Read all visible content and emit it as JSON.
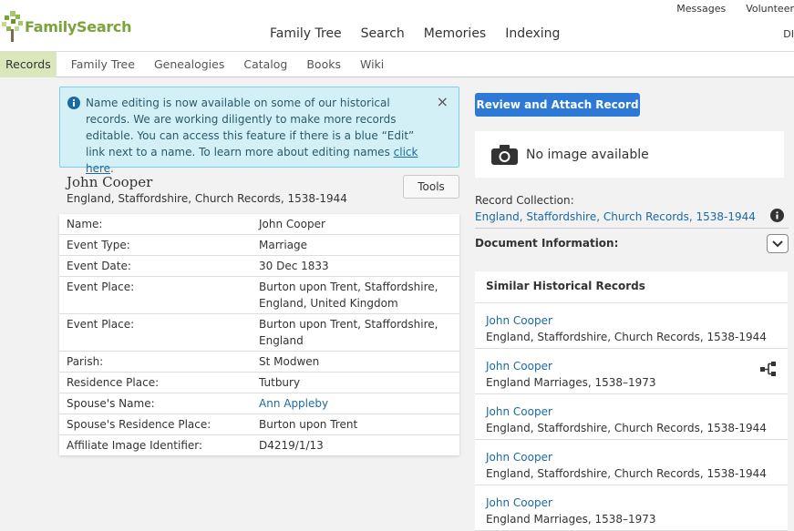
{
  "header": {
    "logo_text": "FamilySearch",
    "top_links": [
      "Messages",
      "Volunteer"
    ],
    "user_initials": "DI",
    "main_nav": [
      "Family Tree",
      "Search",
      "Memories",
      "Indexing"
    ]
  },
  "subnav": {
    "items": [
      "Records",
      "Family Tree",
      "Genealogies",
      "Catalog",
      "Books",
      "Wiki"
    ],
    "active": "Records"
  },
  "notice": {
    "text": "Name editing is now available on some of our historical records. We are working diligently to make more records editable. You can access this feature if there is a blue “Edit” link next to a name. To learn more about editing names ",
    "link_text": "click here",
    "suffix": ".",
    "close_symbol": "×"
  },
  "person": {
    "name": "John Cooper",
    "collection": "England, Staffordshire, Church Records, 1538-1944",
    "tools_label": "Tools"
  },
  "record_rows": [
    {
      "key": "Name:",
      "value": "John Cooper",
      "link": false
    },
    {
      "key": "Event Type:",
      "value": "Marriage",
      "link": false
    },
    {
      "key": "Event Date:",
      "value": "30 Dec 1833",
      "link": false
    },
    {
      "key": "Event Place:",
      "value": "Burton upon Trent, Staffordshire, England, United Kingdom",
      "link": false
    },
    {
      "key": "Event Place:",
      "value": "Burton upon Trent, Staffordshire, England",
      "link": false
    },
    {
      "key": "Parish:",
      "value": "St Modwen",
      "link": false
    },
    {
      "key": "Residence Place:",
      "value": "Tutbury",
      "link": false
    },
    {
      "key": "Spouse's Name:",
      "value": "Ann Appleby",
      "link": true
    },
    {
      "key": "Spouse's Residence Place:",
      "value": "Burton upon Trent",
      "link": false
    },
    {
      "key": "Affiliate Image Identifier:",
      "value": "D4219/1/13",
      "link": false
    }
  ],
  "right": {
    "review_button": "Review and Attach Record",
    "no_image": "No image available",
    "record_collection_label": "Record Collection:",
    "record_collection_link": "England, Staffordshire, Church Records, 1538-1944",
    "document_information": "Document Information:",
    "similar_title": "Similar Historical Records",
    "similar": [
      {
        "name": "John Cooper",
        "collection": "England, Staffordshire, Church Records, 1538-1944",
        "tree_icon": false
      },
      {
        "name": "John Cooper",
        "collection": "England Marriages, 1538–1973",
        "tree_icon": true
      },
      {
        "name": "John Cooper",
        "collection": "England, Staffordshire, Church Records, 1538-1944",
        "tree_icon": false
      },
      {
        "name": "John Cooper",
        "collection": "England, Staffordshire, Church Records, 1538-1944",
        "tree_icon": false
      },
      {
        "name": "John Cooper",
        "collection": "England Marriages, 1538–1973",
        "tree_icon": false
      }
    ]
  },
  "colors": {
    "brand_green": "#7aa33a",
    "link_blue": "#1a6aa3",
    "button_blue": "#2d7ad6",
    "notice_bg": "#d4f0f7",
    "active_tab_bg": "#d9e7bb"
  }
}
